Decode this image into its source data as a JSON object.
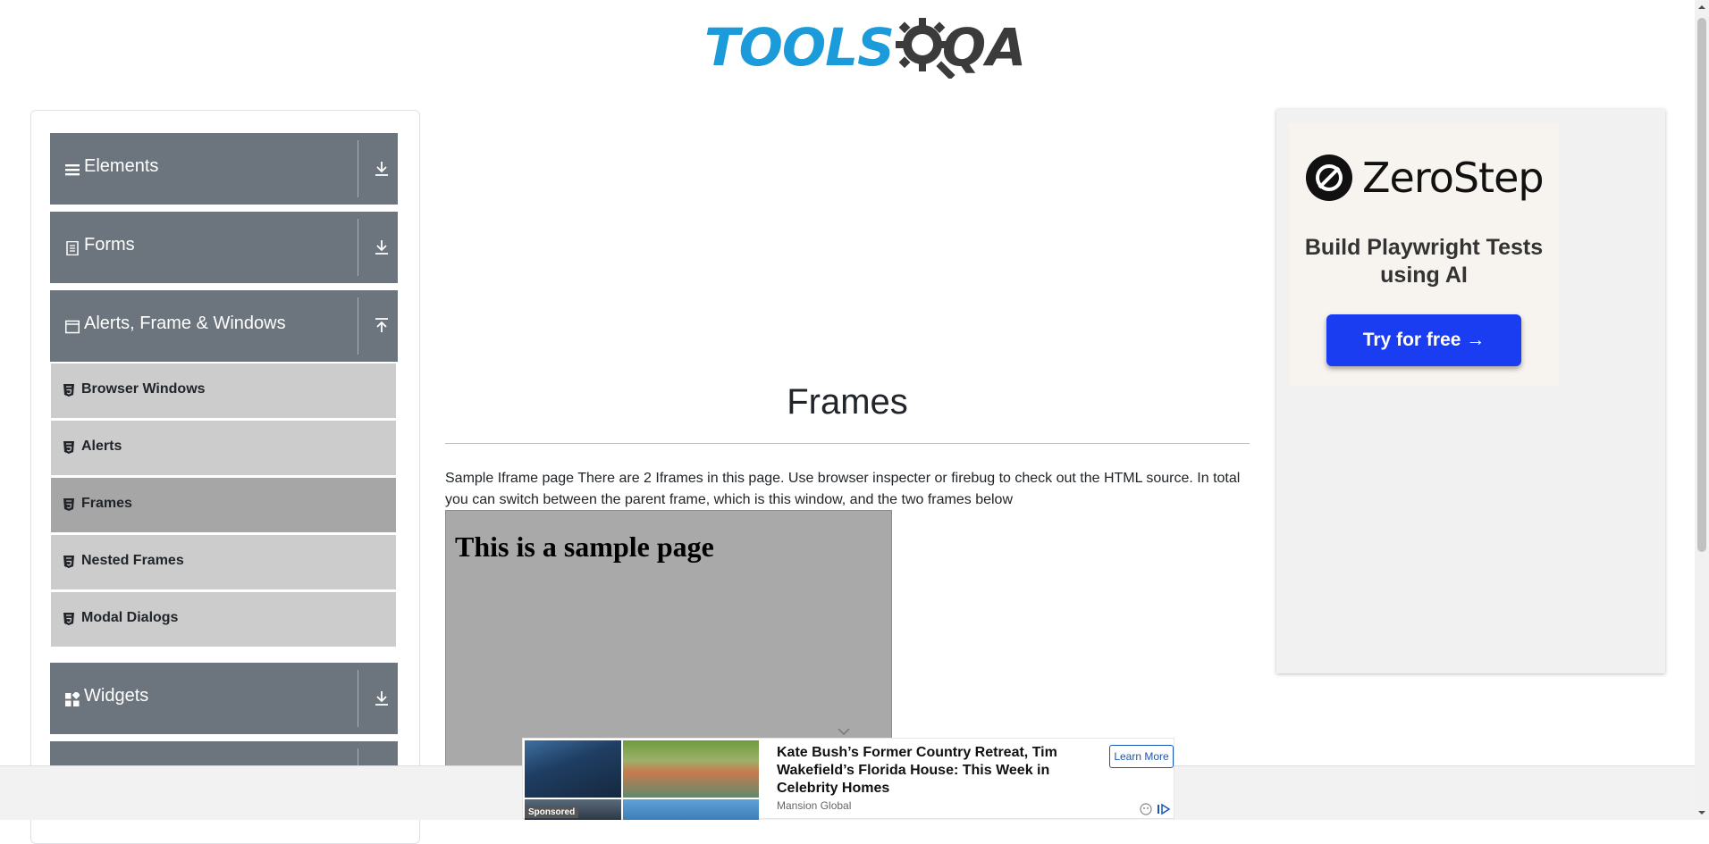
{
  "header": {
    "logo_tools": "TOOLS",
    "logo_qa": "QA"
  },
  "sidebar": {
    "groups": [
      {
        "label": "Elements",
        "icon": "hamburger-icon",
        "expanded": false
      },
      {
        "label": "Forms",
        "icon": "document-icon",
        "expanded": false
      },
      {
        "label": "Alerts, Frame & Windows",
        "icon": "window-icon",
        "expanded": true
      },
      {
        "label": "Widgets",
        "icon": "grid-icon",
        "expanded": false
      }
    ],
    "items": [
      {
        "label": "Browser Windows",
        "active": false
      },
      {
        "label": "Alerts",
        "active": false
      },
      {
        "label": "Frames",
        "active": true
      },
      {
        "label": "Nested Frames",
        "active": false
      },
      {
        "label": "Modal Dialogs",
        "active": false
      }
    ]
  },
  "main": {
    "title": "Frames",
    "description": "Sample Iframe page There are 2 Iframes in this page. Use browser inspecter or firebug to check out the HTML source. In total you can switch between the parent frame, which is this window, and the two frames below",
    "frame_heading": "This is a sample page"
  },
  "right_ad": {
    "brand": "ZeroStep",
    "tagline": "Build Playwright Tests using AI",
    "cta": "Try for free →"
  },
  "bottom_ad": {
    "headline": "Kate Bush’s Former Country Retreat, Tim Wakefield’s Florida House: This Week in Celebrity Homes",
    "source": "Mansion Global",
    "sponsored": "Sponsored",
    "learn_more": "Learn More"
  },
  "colors": {
    "brand_blue": "#1b9bd9",
    "group_header": "#6c757d",
    "menu_item": "#cccccc",
    "menu_item_active": "#a6a6a6",
    "frame_bg": "#a9a9a9",
    "cta_blue": "#1a3df2"
  }
}
